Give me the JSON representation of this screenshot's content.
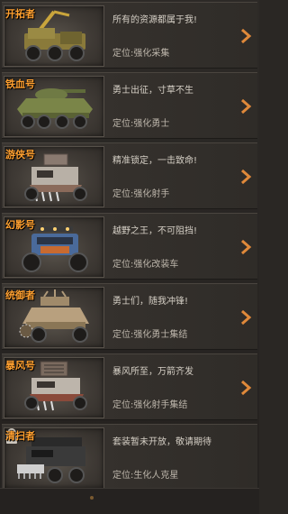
{
  "vehicles": [
    {
      "name": "开拓者",
      "slogan": "所有的资源都属于我!",
      "role": "定位:强化采集",
      "locked": false
    },
    {
      "name": "铁血号",
      "slogan": "勇士出征，寸草不生",
      "role": "定位:强化勇士",
      "locked": false
    },
    {
      "name": "游侠号",
      "slogan": "精准锁定，一击致命!",
      "role": "定位:强化射手",
      "locked": false
    },
    {
      "name": "幻影号",
      "slogan": "越野之王，不可阻挡!",
      "role": "定位:强化改装车",
      "locked": false
    },
    {
      "name": "统御者",
      "slogan": "勇士们，随我冲锋!",
      "role": "定位:强化勇士集结",
      "locked": false
    },
    {
      "name": "暴风号",
      "slogan": "暴风所至，万箭齐发",
      "role": "定位:强化射手集结",
      "locked": false
    },
    {
      "name": "清扫者",
      "slogan": "套装暂未开放，敬请期待",
      "role": "定位:生化人克星",
      "locked": true
    }
  ],
  "colors": {
    "accent": "#ffa030",
    "arrow": "#e0893a"
  }
}
